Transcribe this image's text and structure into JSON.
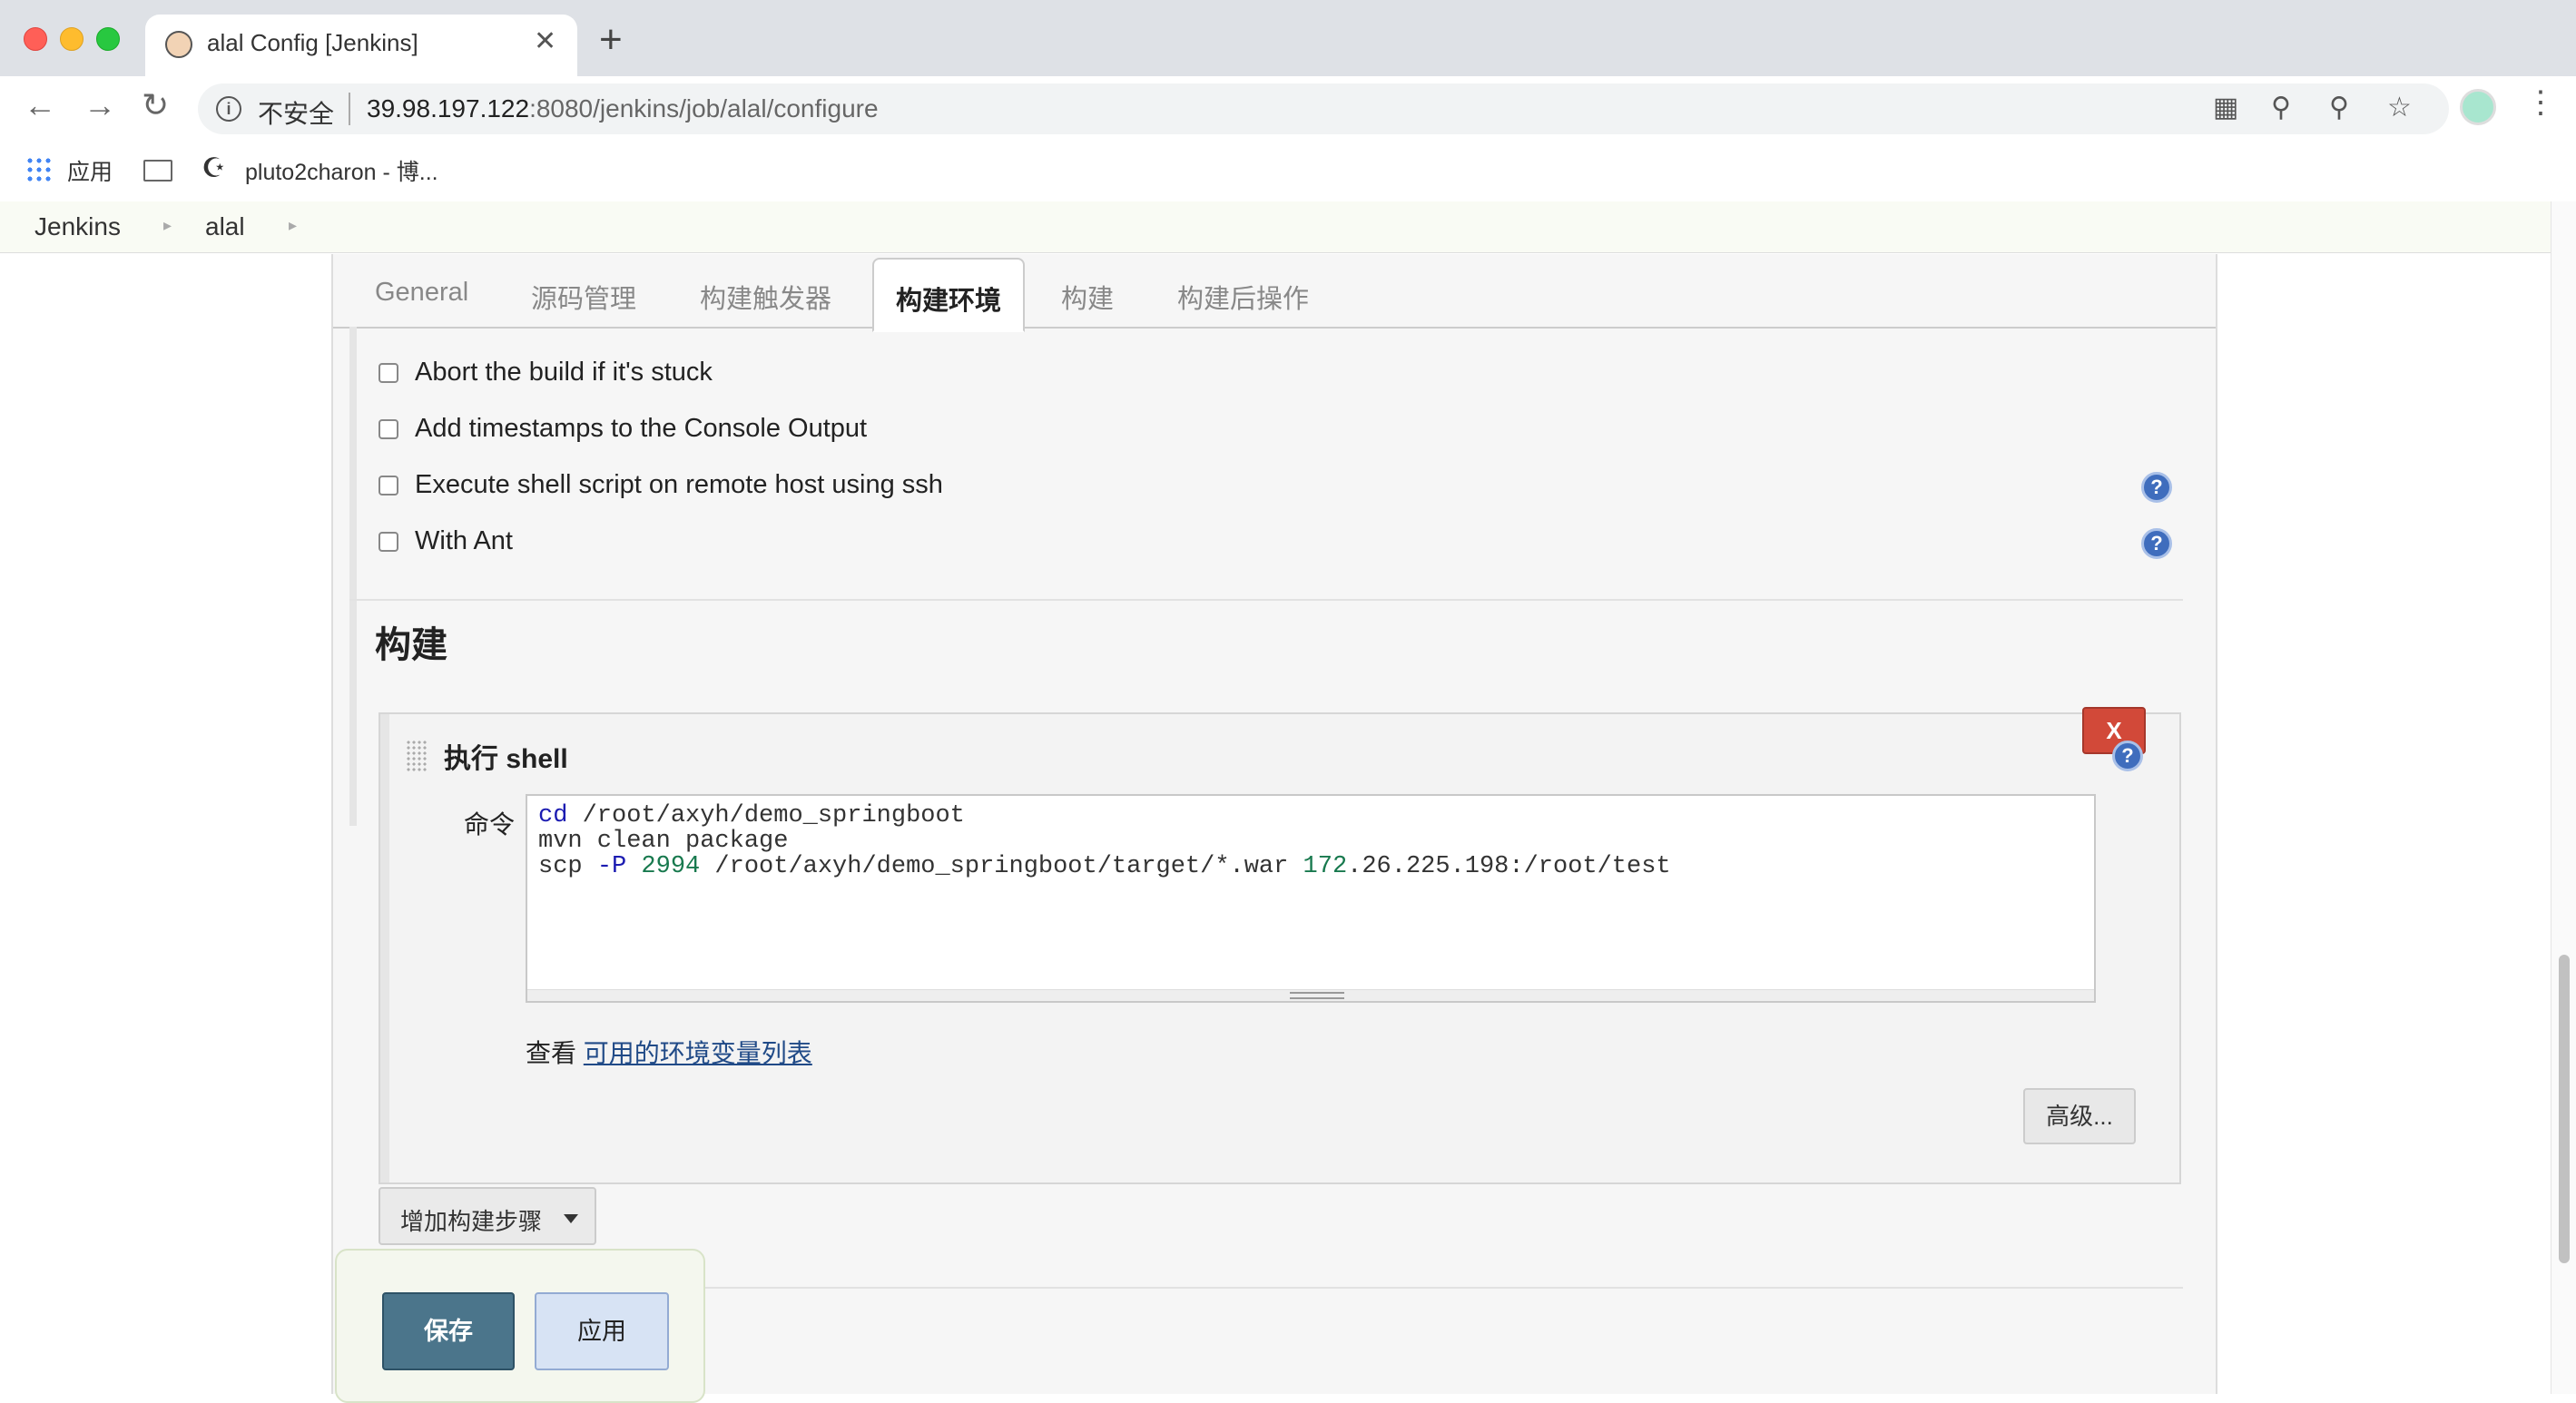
{
  "browser": {
    "tab_title": "alal Config [Jenkins]",
    "tab_close": "✕",
    "new_tab": "+",
    "insecure_label": "不安全",
    "url_host": "39.98.197.122",
    "url_path": ":8080/jenkins/job/alal/configure",
    "bookmarks": {
      "apps_label": "应用",
      "site_label": "pluto2charon - 博..."
    }
  },
  "breadcrumb": {
    "items": [
      "Jenkins",
      "alal"
    ]
  },
  "config_tabs": [
    "General",
    "源码管理",
    "构建触发器",
    "构建环境",
    "构建",
    "构建后操作"
  ],
  "active_tab": "构建环境",
  "build_env": {
    "options": [
      {
        "label": "Abort the build if it's stuck"
      },
      {
        "label": "Add timestamps to the Console Output"
      },
      {
        "label": "Execute shell script on remote host using ssh"
      },
      {
        "label": "With Ant"
      }
    ]
  },
  "build_section": {
    "title": "构建",
    "step": {
      "title": "执行 shell",
      "delete_label": "X",
      "command_label": "命令",
      "command_lines": [
        "cd /root/axyh/demo_springboot",
        "mvn clean package",
        "scp -P 2994 /root/axyh/demo_springboot/target/*.war 172.26.225.198:/root/test"
      ],
      "env_prefix": "查看",
      "env_link": "可用的环境变量列表",
      "advanced_label": "高级..."
    },
    "add_step_label": "增加构建步骤"
  },
  "save_bar": {
    "save_label": "保存",
    "apply_label": "应用"
  },
  "colors": {
    "delete_button": "#d24939",
    "save_button": "#4b758b",
    "apply_button": "#d7e3f4",
    "help_icon": "#3f6dbd"
  }
}
